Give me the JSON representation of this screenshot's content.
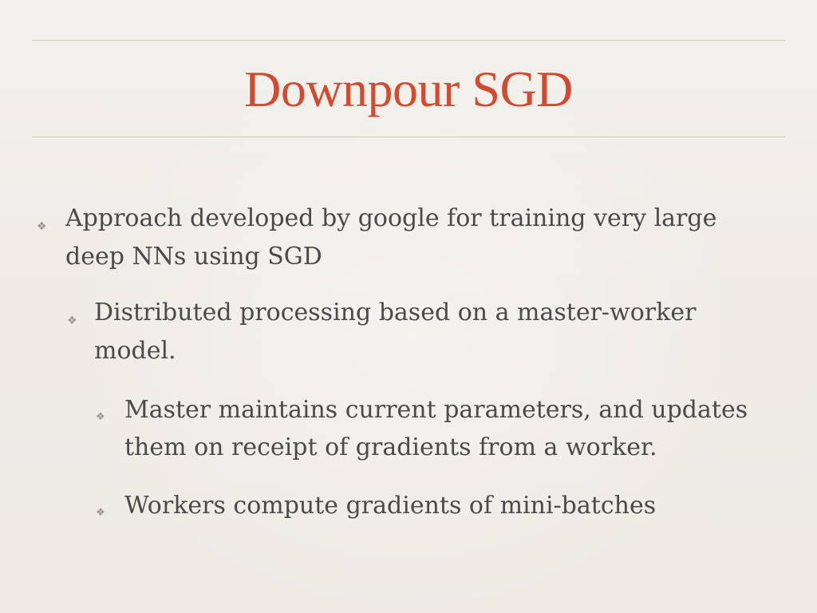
{
  "slide": {
    "title": "Downpour SGD",
    "bullet_glyph": "❖",
    "colors": {
      "title": "#d24a2f",
      "body_text": "#4a4a4a",
      "bullet_mark": "#9a958c",
      "rule": "#cfcbc3",
      "background": "#f1eee8"
    },
    "bullets": [
      {
        "level": 1,
        "text": "Approach developed by google for training very large deep NNs using SGD"
      },
      {
        "level": 2,
        "text": "Distributed processing based on a master-worker model."
      },
      {
        "level": 3,
        "text": "Master maintains current parameters, and updates them on receipt of gradients from a worker."
      },
      {
        "level": 3,
        "text": "Workers compute gradients of mini-batches"
      }
    ]
  }
}
